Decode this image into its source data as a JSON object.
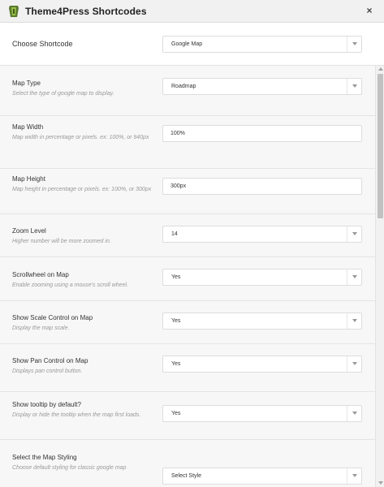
{
  "window": {
    "title": "Theme4Press Shortcodes",
    "close_label": "×"
  },
  "chooser": {
    "label": "Choose Shortcode",
    "value": "Google Map"
  },
  "fields": {
    "map_type": {
      "label": "Map Type",
      "desc": "Select the type of google map to display.",
      "value": "Roadmap"
    },
    "map_width": {
      "label": "Map Width",
      "desc": "Map width in percentage or pixels. ex: 100%, or 940px",
      "value": "100%"
    },
    "map_height": {
      "label": "Map Height",
      "desc": "Map height in percentage or pixels. ex: 100%, or 300px",
      "value": "300px"
    },
    "zoom_level": {
      "label": "Zoom Level",
      "desc": "Higher number will be more zoomed in.",
      "value": "14"
    },
    "scrollwheel": {
      "label": "Scrollwheel on Map",
      "desc": "Enable zooming using a mouse's scroll wheel.",
      "value": "Yes"
    },
    "scale_control": {
      "label": "Show Scale Control on Map",
      "desc": "Display the map scale.",
      "value": "Yes"
    },
    "pan_control": {
      "label": "Show Pan Control on Map",
      "desc": "Displays pan control button.",
      "value": "Yes"
    },
    "tooltip": {
      "label": "Show tooltip by default?",
      "desc": "Display or hide the tooltip when the map first loads.",
      "value": "Yes"
    },
    "map_styling": {
      "label": "Select the Map Styling",
      "desc": "Choose default styling for classic google map",
      "value": "Select Style"
    }
  }
}
